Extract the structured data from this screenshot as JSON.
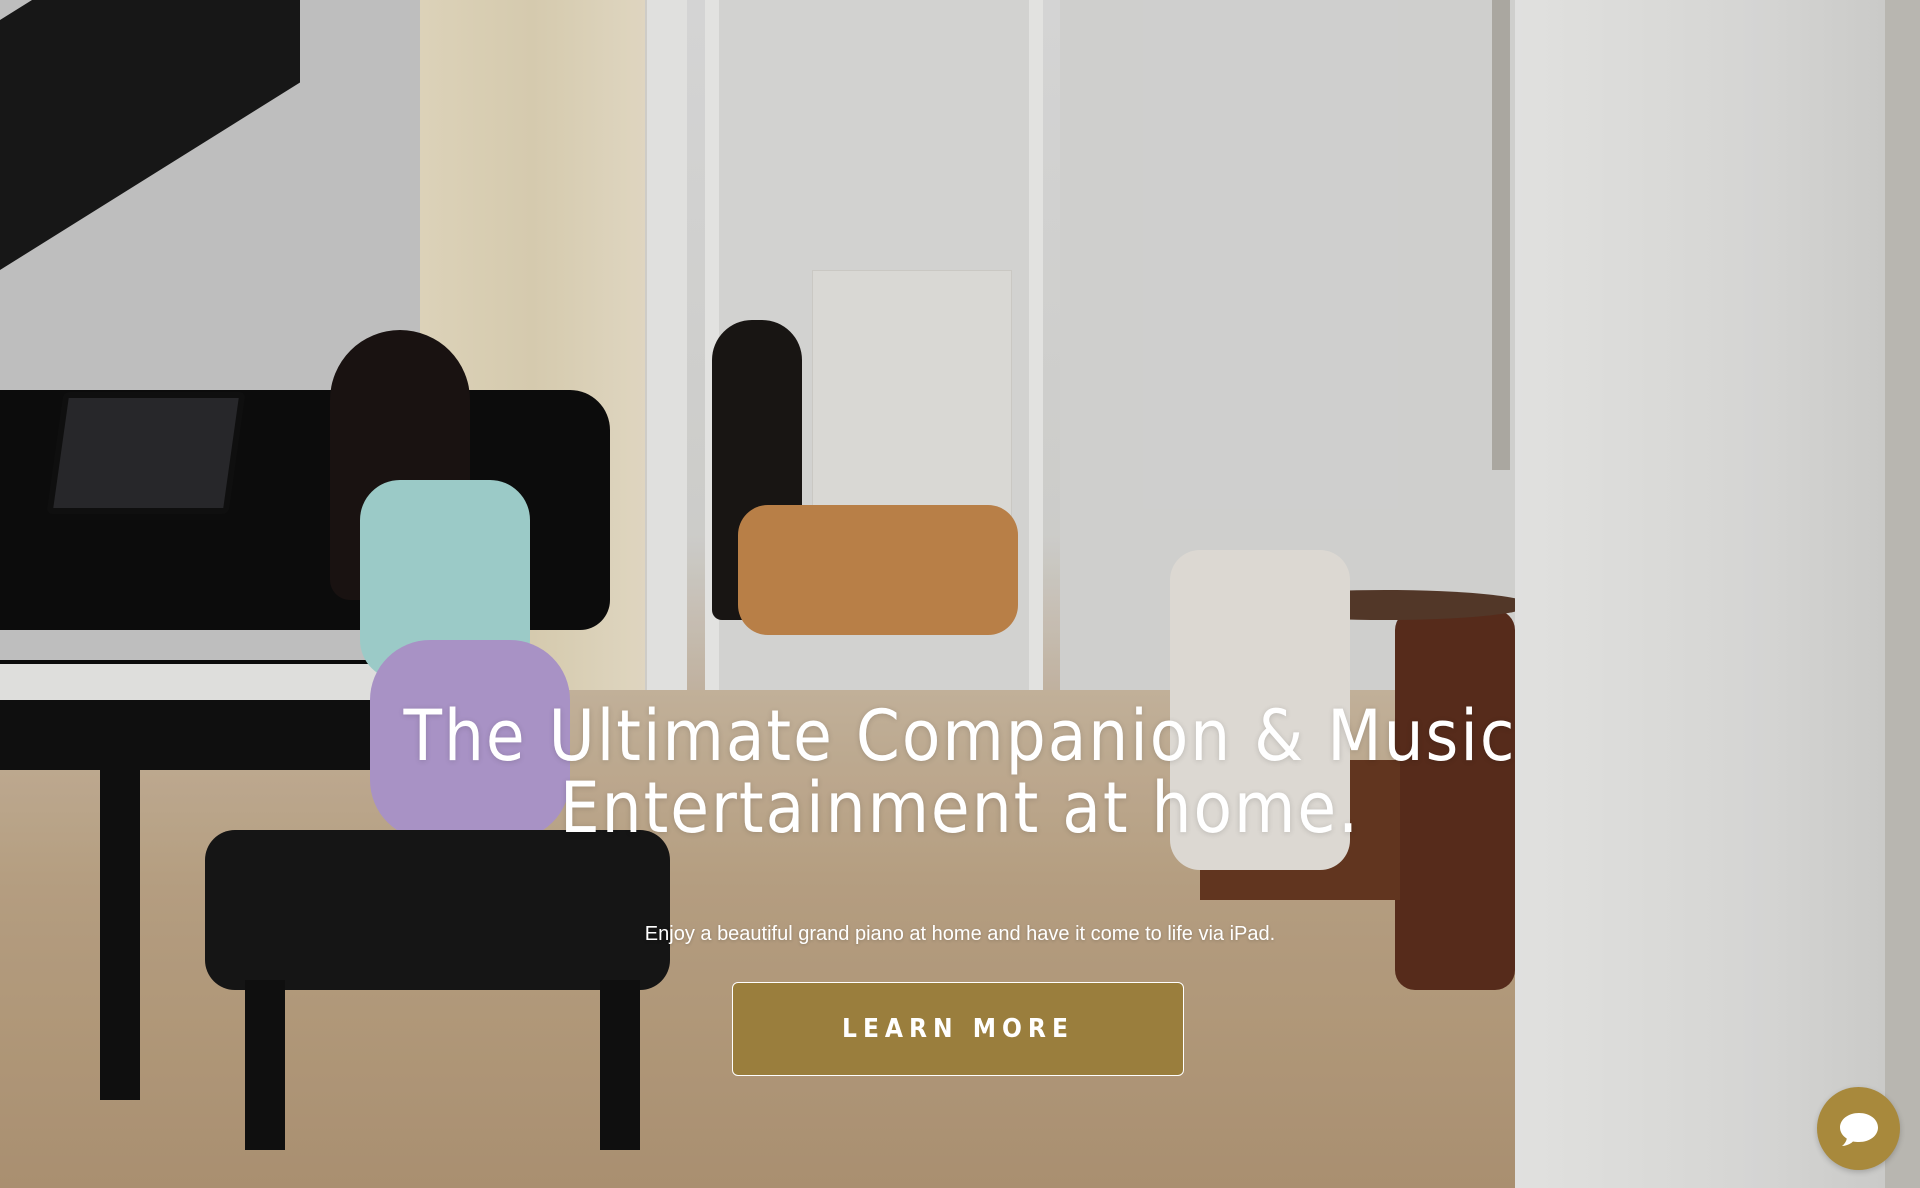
{
  "hero": {
    "headline_line1": "The Ultimate Companion & Music",
    "headline_line2": "Entertainment at home.",
    "subtitle": "Enjoy a beautiful grand piano at home and have it come to life via iPad.",
    "cta_label": "LEARN MORE"
  },
  "chat": {
    "icon": "chat-bubble-icon"
  },
  "colors": {
    "accent": "#9a7e3d",
    "chat_button": "#a8893c",
    "text": "#ffffff"
  }
}
